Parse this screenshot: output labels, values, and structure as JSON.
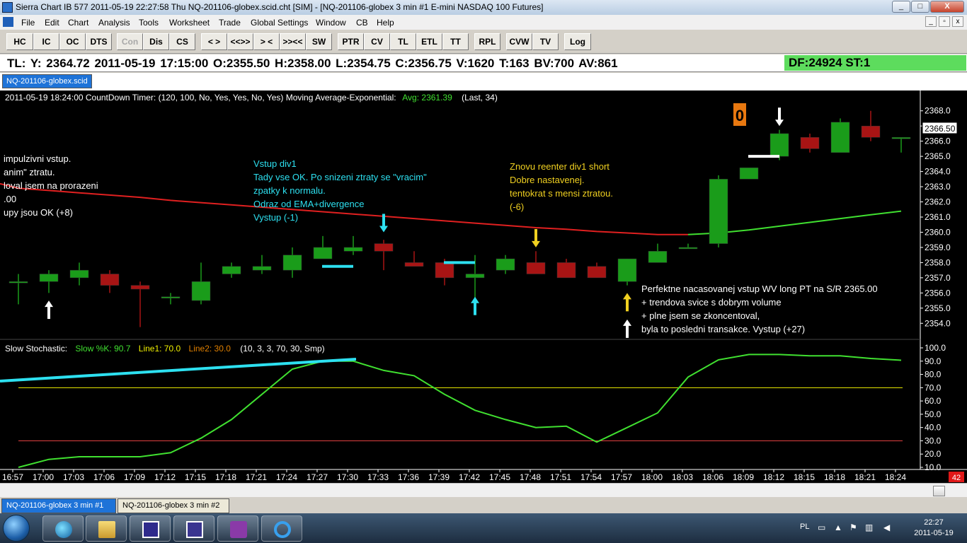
{
  "window": {
    "title": "Sierra Chart IB 577  2011-05-19  22:27:58  Thu   NQ-201106-globex.scid.cht [SIM] - [NQ-201106-globex  3 min   #1  E-mini NASDAQ 100 Futures]",
    "minimize_label": "_",
    "maximize_label": "□",
    "close_label": "X"
  },
  "menu": {
    "items": [
      "File",
      "Edit",
      "Chart",
      "Analysis",
      "Tools",
      "Worksheet",
      "Trade",
      "Global Settings",
      "Window",
      "CB",
      "Help"
    ],
    "mdi_buttons": [
      "_",
      "▫",
      "x"
    ]
  },
  "toolbar": {
    "buttons": [
      {
        "label": "HC"
      },
      {
        "label": "IC"
      },
      {
        "label": "OC"
      },
      {
        "label": "DTS"
      },
      {
        "label": "Con",
        "disabled": true
      },
      {
        "label": "Dis"
      },
      {
        "label": "CS"
      },
      {
        "label": "< >"
      },
      {
        "label": "<<>>"
      },
      {
        "label": "> <"
      },
      {
        "label": ">><<"
      },
      {
        "label": "SW"
      },
      {
        "label": "PTR"
      },
      {
        "label": "CV"
      },
      {
        "label": "TL"
      },
      {
        "label": "ETL"
      },
      {
        "label": "TT"
      },
      {
        "label": "RPL"
      },
      {
        "label": "CVW"
      },
      {
        "label": "TV"
      },
      {
        "label": "Log"
      }
    ]
  },
  "infobar": {
    "text": "TL: Y: 2364.72  2011-05-19  17:15:00  O:2355.50  H:2358.00  L:2354.75  C:2356.75  V:1620  T:163  BV:700  AV:861",
    "df_text": "DF:24924  ST:1",
    "df_color": "#5ddc5d"
  },
  "chart_tab": "NQ-201106-globex.scid",
  "chart_header": {
    "prefix": "2011-05-19 18:24:00 CountDown Timer:   (120, 100, No, Yes, Yes, No, Yes)   Moving Average-Exponential:",
    "avg": "Avg: 2361.39",
    "suffix": "(Last, 34)"
  },
  "stoch_header": {
    "label": "Slow Stochastic:",
    "k": "Slow %K: 90.7",
    "line1": "Line1: 70.0",
    "line2": "Line2: 30.0",
    "params": "(10, 3, 3, 70, 30, Smp)"
  },
  "countdown": "0",
  "price_marker": "2366.50",
  "scroll_badge": "42",
  "annotations": [
    {
      "color": "#ffffff",
      "lines": [
        "impulzivni vstup.",
        "anim\"  ztratu.",
        "loval jsem na prorazeni",
        ".00",
        "upy jsou OK (+8)"
      ]
    },
    {
      "color": "#2de0f0",
      "lines": [
        "Vstup div1",
        "Tady vse OK. Po snizeni ztraty se \"vracim\"",
        "zpatky k normalu.",
        "Odraz od EMA+divergence",
        "Vystup (-1)"
      ]
    },
    {
      "color": "#f0d020",
      "lines": [
        "Znovu reenter div1 short",
        "Dobre nastavenej.",
        "tentokrat s mensi ztratou.",
        "(-6)"
      ]
    },
    {
      "color": "#ffffff",
      "lines": [
        "Perfektne nacasovanej vstup WV long PT na S/R 2365.00",
        "+ trendova svice s dobrym volume",
        "+ plne jsem se zkoncentoval,",
        "byla to posledni transakce. Vystup (+27)"
      ]
    }
  ],
  "colors": {
    "up_candle": "#1a9c1a",
    "down_candle": "#a81414",
    "ema": "#e02020",
    "ema_up": "#40e030",
    "stoch": "#40e030",
    "line1": "#f0f000",
    "line2": "#e04040",
    "trendline": "#2de0f0"
  },
  "chart_data": {
    "type": "candlestick",
    "x": [
      "16:57",
      "17:00",
      "17:03",
      "17:06",
      "17:09",
      "17:12",
      "17:15",
      "17:18",
      "17:21",
      "17:24",
      "17:27",
      "17:30",
      "17:33",
      "17:36",
      "17:39",
      "17:42",
      "17:45",
      "17:48",
      "17:51",
      "17:54",
      "17:57",
      "18:00",
      "18:03",
      "18:06",
      "18:09",
      "18:12",
      "18:15",
      "18:18",
      "18:21",
      "18:24"
    ],
    "open": [
      2356.75,
      2356.75,
      2357.0,
      2357.25,
      2356.5,
      2355.75,
      2355.5,
      2357.25,
      2357.5,
      2357.5,
      2358.25,
      2358.75,
      2359.25,
      2358.0,
      2358.0,
      2357.0,
      2357.5,
      2358.0,
      2358.0,
      2357.75,
      2356.75,
      2358.0,
      2359.0,
      2359.25,
      2363.5,
      2365.0,
      2366.25,
      2365.25,
      2367.0,
      2366.25
    ],
    "high": [
      2357.25,
      2357.5,
      2358.0,
      2357.5,
      2356.75,
      2356.0,
      2358.0,
      2358.0,
      2358.5,
      2359.0,
      2359.75,
      2359.75,
      2359.5,
      2358.75,
      2358.25,
      2358.5,
      2358.5,
      2358.75,
      2358.25,
      2358.0,
      2358.25,
      2359.25,
      2359.25,
      2363.75,
      2364.25,
      2366.75,
      2366.5,
      2367.5,
      2368.0,
      2366.25
    ],
    "low": [
      2355.25,
      2356.0,
      2356.5,
      2356.0,
      2353.75,
      2355.25,
      2355.25,
      2357.0,
      2357.25,
      2357.0,
      2358.25,
      2358.5,
      2357.5,
      2357.75,
      2356.5,
      2355.5,
      2357.25,
      2357.25,
      2357.0,
      2357.0,
      2356.5,
      2358.0,
      2359.0,
      2359.0,
      2363.5,
      2364.75,
      2365.25,
      2365.25,
      2366.0,
      2365.25
    ],
    "close": [
      2356.75,
      2357.25,
      2357.5,
      2356.5,
      2356.25,
      2355.75,
      2356.75,
      2357.75,
      2357.75,
      2358.5,
      2359.0,
      2359.0,
      2358.75,
      2357.75,
      2357.0,
      2357.25,
      2358.25,
      2357.25,
      2357.0,
      2357.0,
      2358.25,
      2358.75,
      2359.0,
      2363.5,
      2364.25,
      2366.5,
      2365.5,
      2367.25,
      2366.25,
      2366.25
    ],
    "ema": [
      2362.9,
      2362.75,
      2362.6,
      2362.45,
      2362.3,
      2362.1,
      2361.95,
      2361.8,
      2361.65,
      2361.5,
      2361.35,
      2361.2,
      2361.05,
      2360.9,
      2360.75,
      2360.6,
      2360.45,
      2360.3,
      2360.2,
      2360.05,
      2359.95,
      2359.85,
      2359.85,
      2359.95,
      2360.15,
      2360.4,
      2360.65,
      2360.9,
      2361.15,
      2361.39
    ],
    "ema_up_from_index": 22,
    "stochastic_k": [
      10,
      16,
      18,
      18,
      18,
      21,
      32,
      46,
      65,
      84,
      90,
      90,
      83,
      79,
      65,
      53,
      46,
      40,
      41,
      29,
      40,
      51,
      78,
      91,
      95,
      95,
      94,
      94,
      92,
      90.7
    ],
    "stoch_line1": 70,
    "stoch_line2": 30,
    "stoch_ylim": [
      10,
      100
    ],
    "stoch_ticks": [
      10.0,
      20.0,
      30.0,
      40.0,
      50.0,
      60.0,
      70.0,
      80.0,
      90.0,
      100.0
    ],
    "price_ylim": [
      2353.5,
      2368.5
    ],
    "price_ticks": [
      2354.0,
      2355.0,
      2356.0,
      2357.0,
      2358.0,
      2359.0,
      2360.0,
      2361.0,
      2362.0,
      2363.0,
      2364.0,
      2365.0,
      2366.0,
      2367.0,
      2368.0
    ],
    "last_price": 2366.5,
    "entry_marks": [
      {
        "index": 11,
        "price": 2357.75,
        "side": "buy-exit",
        "color": "#2de0f0"
      },
      {
        "index": 15,
        "price": 2358.0,
        "side": "sell",
        "color": "#2de0f0"
      },
      {
        "index": 25,
        "price": 2365.0,
        "side": "sell",
        "color": "#ffffff"
      }
    ],
    "arrows": [
      {
        "index": 1,
        "dir": "up",
        "price": 2355.5,
        "color": "#ffffff"
      },
      {
        "index": 12,
        "dir": "down",
        "price": 2360.0,
        "color": "#2de0f0"
      },
      {
        "index": 15,
        "dir": "up",
        "price": 2355.75,
        "color": "#2de0f0"
      },
      {
        "index": 17,
        "dir": "down",
        "price": 2359.0,
        "color": "#f0d020"
      },
      {
        "index": 20,
        "dir": "up",
        "price": 2356.0,
        "color": "#f0d020"
      },
      {
        "index": 20,
        "dir": "up",
        "price": 2354.25,
        "color": "#ffffff"
      },
      {
        "index": 25,
        "dir": "down",
        "price": 2367.0,
        "color": "#ffffff"
      }
    ],
    "stoch_trendline": {
      "from_index": 0,
      "to_index": 11,
      "from_value": 75,
      "to_value": 91.5
    }
  },
  "bottom_tabs": [
    "NQ-201106-globex  3 min   #1",
    "NQ-201106-globex  3 min   #2"
  ],
  "tray": {
    "lang": "PL",
    "time": "22:27",
    "date": "2011-05-19"
  }
}
